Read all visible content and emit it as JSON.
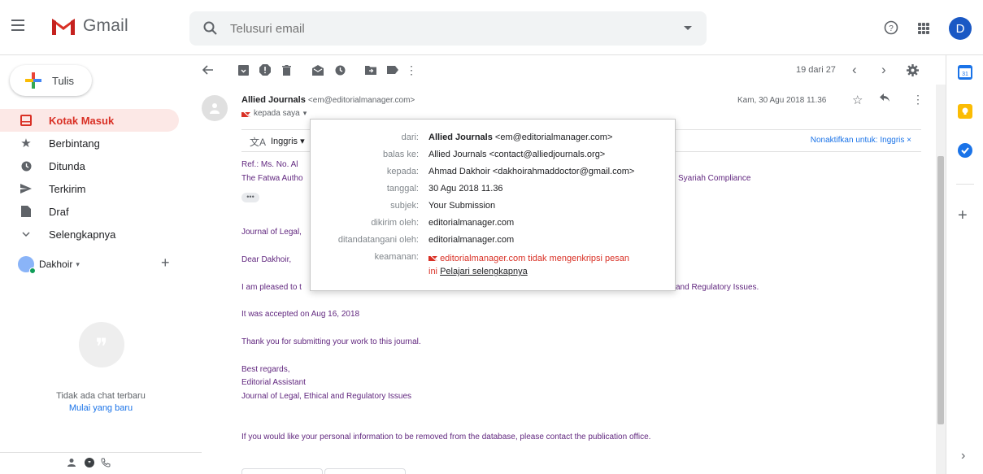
{
  "app": {
    "name": "Gmail"
  },
  "search": {
    "placeholder": "Telusuri email"
  },
  "user": {
    "initial": "D"
  },
  "sidebar": {
    "compose_label": "Tulis",
    "items": [
      {
        "label": "Kotak Masuk",
        "icon": "inbox-icon"
      },
      {
        "label": "Berbintang",
        "icon": "star-icon"
      },
      {
        "label": "Ditunda",
        "icon": "clock-icon"
      },
      {
        "label": "Terkirim",
        "icon": "send-icon"
      },
      {
        "label": "Draf",
        "icon": "draft-icon"
      },
      {
        "label": "Selengkapnya",
        "icon": "chevron-down-icon"
      }
    ],
    "hangouts_user": "Dakhoir",
    "no_chat_text": "Tidak ada chat terbaru",
    "start_chat": "Mulai yang baru"
  },
  "toolbar": {
    "counter": "19 dari 27"
  },
  "message": {
    "sender_name": "Allied Journals",
    "sender_email": "<em@editorialmanager.com>",
    "to": "kepada saya",
    "date": "Kam, 30 Agu 2018 11.36",
    "translate": {
      "language": "Inggris",
      "disable": "Nonaktifkan untuk: Inggris"
    },
    "body": {
      "ref_line": "Ref.: Ms. No. Al",
      "ref_line_end": "Syariah Compliance",
      "title_line": "The Fatwa Autho",
      "journal_line": "Journal of Legal,",
      "greeting": "Dear Dakhoir,",
      "pleased_line": "I am pleased to t",
      "pleased_line_end": "and Regulatory Issues.",
      "accepted": "It was accepted on Aug 16, 2018",
      "thanks": "Thank you for submitting your work to this journal.",
      "regards": "Best regards,",
      "signer": "Editorial Assistant",
      "journal_full": "Journal of Legal, Ethical and Regulatory Issues",
      "footer": "If you would like your personal information to be removed from the database, please contact the publication office."
    }
  },
  "details_popup": {
    "from_label": "dari:",
    "from_name": "Allied Journals",
    "from_email": "<em@editorialmanager.com>",
    "reply_to_label": "balas ke:",
    "reply_to": "Allied Journals <contact@alliedjournals.org>",
    "to_label": "kepada:",
    "to": "Ahmad Dakhoir <dakhoirahmaddoctor@gmail.com>",
    "date_label": "tanggal:",
    "date": "30 Agu 2018 11.36",
    "subject_label": "subjek:",
    "subject": "Your Submission",
    "mailed_by_label": "dikirim oleh:",
    "mailed_by": "editorialmanager.com",
    "signed_by_label": "ditandatangani oleh:",
    "signed_by": "editorialmanager.com",
    "security_label": "keamanan:",
    "security_text_1": "editorialmanager.com tidak mengenkripsi pesan",
    "security_text_2": "ini",
    "learn_more": "Pelajari selengkapnya"
  },
  "colors": {
    "accent_red": "#d93025",
    "link_blue": "#1a73e8",
    "body_purple": "#61277f"
  }
}
